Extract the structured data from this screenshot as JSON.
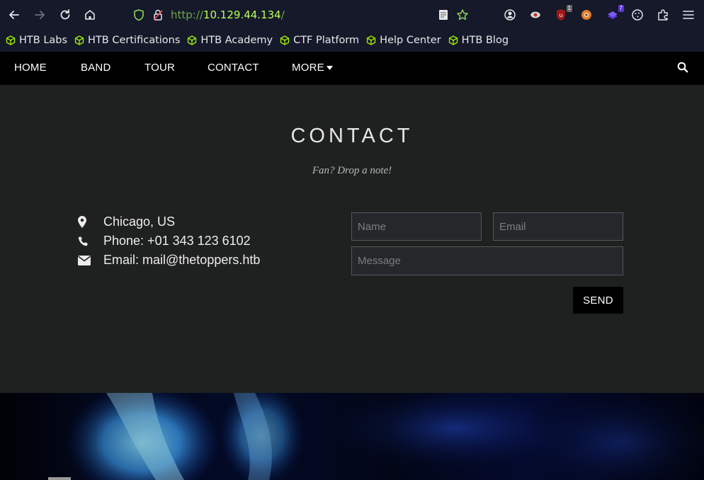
{
  "browser": {
    "url_protocol": "http://",
    "url_host": "10.129.44.134",
    "url_path": "/",
    "extensions": [
      {
        "name": "container-icon",
        "badge": ""
      },
      {
        "name": "ublock-icon",
        "badge": "1"
      },
      {
        "name": "foxy-icon",
        "badge": ""
      },
      {
        "name": "extension-purple-icon",
        "badge": "7"
      }
    ],
    "bookmarks": [
      "HTB Labs",
      "HTB Certifications",
      "HTB Academy",
      "CTF Platform",
      "Help Center",
      "HTB Blog"
    ]
  },
  "nav": {
    "home": "HOME",
    "band": "BAND",
    "tour": "TOUR",
    "contact": "CONTACT",
    "more": "MORE"
  },
  "contact": {
    "title": "CONTACT",
    "subtitle": "Fan? Drop a note!",
    "location": "Chicago, US",
    "phone": "Phone: +01 343 123 6102",
    "email": "Email: mail@thetoppers.htb"
  },
  "form": {
    "name_placeholder": "Name",
    "email_placeholder": "Email",
    "message_placeholder": "Message",
    "send_label": "SEND"
  },
  "colors": {
    "nav_bg": "#000000",
    "section_bg": "#1f2120",
    "url_green": "#b8ff5a",
    "bookmark_icon": "#9fef00"
  }
}
